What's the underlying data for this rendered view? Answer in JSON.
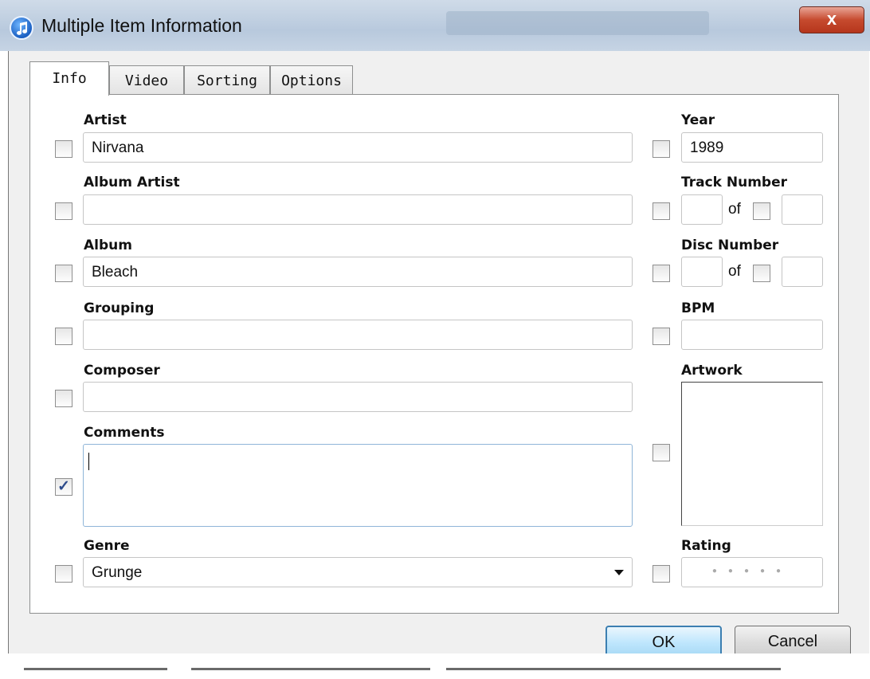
{
  "window": {
    "title": "Multiple Item Information",
    "close_label": "x"
  },
  "tabs": [
    {
      "label": "Info",
      "active": true
    },
    {
      "label": "Video",
      "active": false
    },
    {
      "label": "Sorting",
      "active": false
    },
    {
      "label": "Options",
      "active": false
    }
  ],
  "info": {
    "artist": {
      "label": "Artist",
      "value": "Nirvana",
      "checked": false
    },
    "album_artist": {
      "label": "Album Artist",
      "value": "",
      "checked": false
    },
    "album": {
      "label": "Album",
      "value": "Bleach",
      "checked": false
    },
    "grouping": {
      "label": "Grouping",
      "value": "",
      "checked": false
    },
    "composer": {
      "label": "Composer",
      "value": "",
      "checked": false
    },
    "comments": {
      "label": "Comments",
      "value": "",
      "checked": true
    },
    "genre": {
      "label": "Genre",
      "value": "Grunge",
      "checked": false
    },
    "year": {
      "label": "Year",
      "value": "1989",
      "checked": false
    },
    "track_number": {
      "label": "Track Number",
      "value": "",
      "of_label": "of",
      "total": "",
      "checked": false
    },
    "disc_number": {
      "label": "Disc Number",
      "value": "",
      "of_label": "of",
      "total": "",
      "checked": false
    },
    "bpm": {
      "label": "BPM",
      "value": "",
      "checked": false
    },
    "artwork": {
      "label": "Artwork",
      "checked": false
    },
    "rating": {
      "label": "Rating",
      "stars": 0,
      "max": 5,
      "checked": false
    }
  },
  "buttons": {
    "ok": "OK",
    "cancel": "Cancel"
  },
  "colors": {
    "ok_border": "#3c7fb1",
    "close_red": "#c64a2e"
  }
}
